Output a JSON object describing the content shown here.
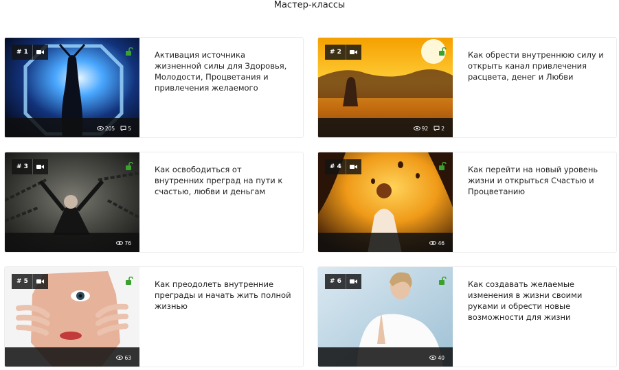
{
  "page": {
    "title": "Мастер-классы"
  },
  "accent": {
    "lock_color": "#3aa02f"
  },
  "cards": [
    {
      "number": "# 1",
      "title": "Активация источника жизненной силы для Здоровья, Молодости, Процветания и привлечения желаемого",
      "views": "205",
      "comments": "5",
      "icon": "video-icon"
    },
    {
      "number": "# 2",
      "title": "Как обрести внутреннюю силу и открыть канал привлечения расцвета, денег и Любви",
      "views": "92",
      "comments": "2",
      "icon": "video-icon"
    },
    {
      "number": "# 3",
      "title": "Как освободиться от внутренних преград на пути к счастью, любви и деньгам",
      "views": "76",
      "icon": "video-icon"
    },
    {
      "number": "# 4",
      "title": "Как перейти на новый уровень жизни и открыться Счастью и Процветанию",
      "views": "46",
      "icon": "video-icon"
    },
    {
      "number": "# 5",
      "title": "Как преодолеть внутренние преграды и начать жить полной жизнью",
      "views": "63",
      "icon": "video-icon"
    },
    {
      "number": "# 6",
      "title": "Как создавать желаемые изменения в жизни своими руками и обрести новые возможности для жизни",
      "views": "40",
      "icon": "video-icon"
    }
  ]
}
